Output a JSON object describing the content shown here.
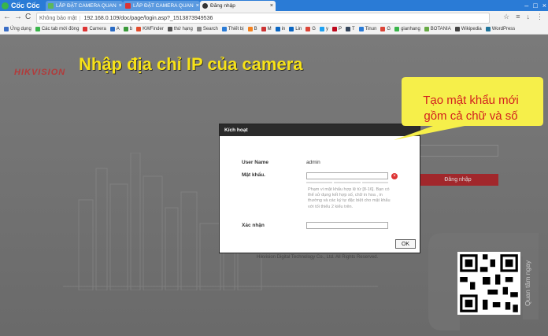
{
  "browser": {
    "brand_label": "Cốc Cốc",
    "tabs": [
      {
        "label": "LẮP ĐẶT CAMERA QUAN",
        "close": "×"
      },
      {
        "label": "LẮP ĐẶT CAMERA QUAN",
        "close": "×"
      },
      {
        "label": "Đăng nhập",
        "close": "×"
      }
    ],
    "window_controls": [
      "–",
      "□",
      "×"
    ],
    "nav": {
      "back": "←",
      "forward": "→",
      "reload": "C"
    },
    "address": {
      "secure_label": "Không bảo mật",
      "url": "192.168.0.109/doc/page/login.asp?_1513873949536"
    },
    "toolbar_icons": [
      "☆",
      "≡",
      "↓",
      "⋮"
    ],
    "bookmarks": [
      {
        "label": "Ứng dụng",
        "color": "#3b6ec6"
      },
      {
        "label": "Các tab mới đóng",
        "color": "#39b54a"
      },
      {
        "label": "Camera",
        "color": "#d33"
      },
      {
        "label": "A",
        "color": "#2a6bc4"
      },
      {
        "label": "b",
        "color": "#3a9a3a"
      },
      {
        "label": "KWFinder",
        "color": "#e24b2b"
      },
      {
        "label": "thứ hạng",
        "color": "#555"
      },
      {
        "label": "Search",
        "color": "#888"
      },
      {
        "label": "Thiết bị",
        "color": "#2a7bd6"
      },
      {
        "label": "B",
        "color": "#f4821f"
      },
      {
        "label": "M",
        "color": "#c33"
      },
      {
        "label": "in",
        "color": "#0a66c2"
      },
      {
        "label": "Lin",
        "color": "#0a66c2"
      },
      {
        "label": "G",
        "color": "#db4437"
      },
      {
        "label": "y",
        "color": "#1da1f2"
      },
      {
        "label": "P",
        "color": "#bd081c"
      },
      {
        "label": "T",
        "color": "#35465c"
      },
      {
        "label": "Tinun",
        "color": "#2a7bd6"
      },
      {
        "label": "G",
        "color": "#db4437"
      },
      {
        "label": "gianhang",
        "color": "#39b54a"
      },
      {
        "label": "BOTANIA",
        "color": "#6a4"
      },
      {
        "label": "Wikipedia",
        "color": "#444"
      },
      {
        "label": "WordPress",
        "color": "#21759b"
      }
    ]
  },
  "page": {
    "logo": "HIKVISION",
    "heading": "Nhập địa chỉ IP của camera",
    "bg_login_button": "Đăng nhập",
    "footer": "Hikvision Digital Technology Co., Ltd. All Rights Reserved."
  },
  "modal": {
    "title": "Kích hoạt",
    "username_label": "User Name",
    "username_value": "admin",
    "password_label": "Mật khẩu.",
    "password_hint": "Phạm vi mật khẩu hợp lệ từ [8-16]. Bạn có thể sử dụng kết hợp số, chữ in hoa , in thường và các ký tự đặc biệt cho mật khẩu với tối thiểu 2 kiểu trên.",
    "confirm_label": "Xác nhận",
    "ok_label": "OK",
    "error_icon": "×"
  },
  "callout": {
    "text_line1": "Tạo mật khẩu mới",
    "text_line2": "gồm cả chữ và số",
    "fill_color": "#f6ef4a"
  },
  "watermark": {
    "side_text": "Quan tâm ngay"
  }
}
